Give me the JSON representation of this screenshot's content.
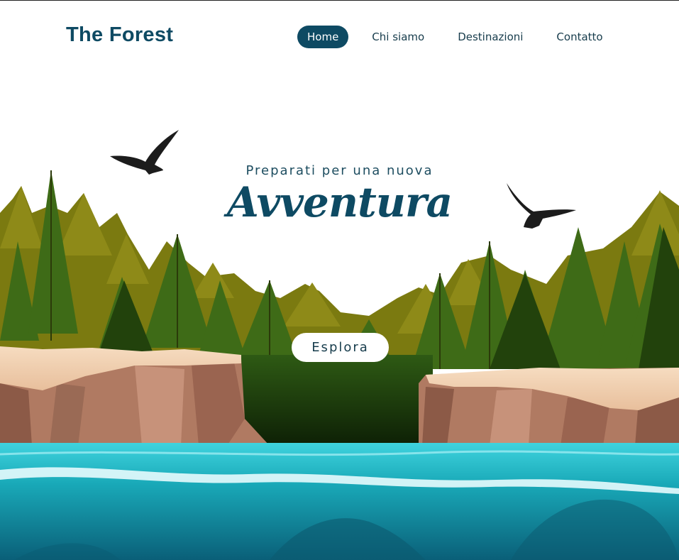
{
  "header": {
    "logo": "The Forest",
    "nav": [
      {
        "label": "Home",
        "active": true
      },
      {
        "label": "Chi siamo",
        "active": false
      },
      {
        "label": "Destinazioni",
        "active": false
      },
      {
        "label": "Contatto",
        "active": false
      }
    ]
  },
  "hero": {
    "kicker": "Preparati per una nuova",
    "headline": "Avventura",
    "cta_label": "Esplora"
  },
  "colors": {
    "brand": "#0e4a63",
    "water": "#0f9aa3",
    "forest_olive": "#7a7a12",
    "forest_green": "#2f5a18",
    "cliff": "#b07a62"
  }
}
